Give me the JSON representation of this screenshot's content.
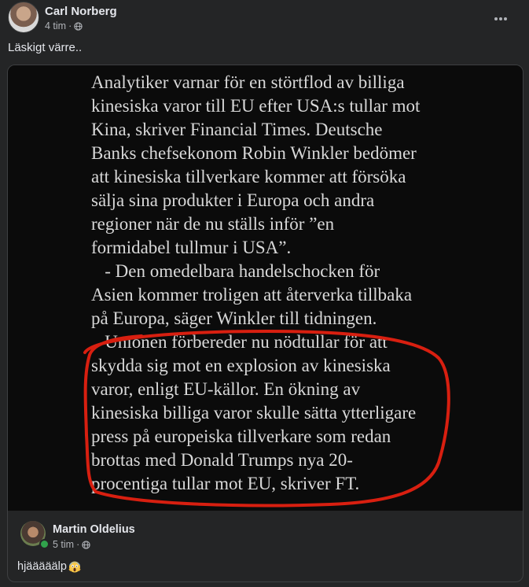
{
  "post": {
    "author": "Carl Norberg",
    "time": "4 tim",
    "separator": "·",
    "text": "Läskigt värre..",
    "more_icon": "ellipsis-icon",
    "privacy_icon": "globe-icon"
  },
  "shared_image": {
    "article_lines": [
      "Analytiker varnar för en störtflod av billiga",
      "kinesiska varor till EU efter USA:s tullar mot",
      "Kina, skriver Financial Times. Deutsche",
      "Banks chefsekonom Robin Winkler bedömer",
      "att kinesiska tillverkare kommer att försöka",
      "sälja sina produkter i Europa och andra",
      "regioner när de nu ställs inför ”en",
      "formidabel tullmur i USA”.",
      "   - Den omedelbara handelschocken för",
      "Asien kommer troligen att återverka tillbaka",
      "på Europa, säger Winkler till tidningen.",
      "   Unionen förbereder nu nödtullar för att",
      "skydda sig mot en explosion av kinesiska",
      "varor, enligt EU-källor. En ökning av",
      "kinesiska billiga varor skulle sätta ytterligare",
      "press på europeiska tillverkare som redan",
      "brottas med Donald Trumps nya 20-",
      "procentiga tullar mot EU, skriver FT."
    ],
    "highlight_color": "#d81f10"
  },
  "sharer": {
    "name": "Martin Oldelius",
    "time": "5 tim",
    "separator": "·",
    "text": "hjääääälp",
    "emoji": "face-screaming-in-fear-icon",
    "status": "online"
  },
  "colors": {
    "background": "#242526",
    "primary_text": "#e4e6eb",
    "secondary_text": "#b0b3b8",
    "online": "#31a24c"
  }
}
